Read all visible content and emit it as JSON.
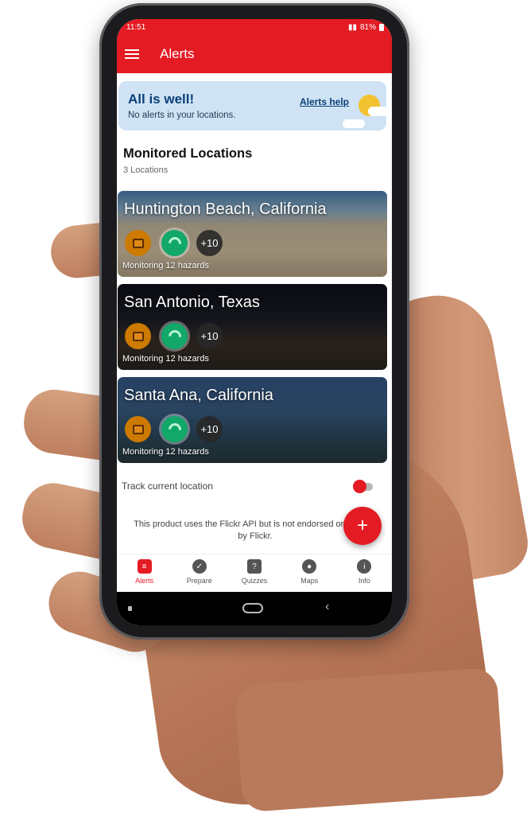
{
  "status_bar": {
    "time": "11:51",
    "battery": "81%"
  },
  "app_bar": {
    "title": "Alerts"
  },
  "banner": {
    "title": "All is well!",
    "subtitle": "No alerts in your locations.",
    "help_link": "Alerts help"
  },
  "monitored": {
    "title": "Monitored Locations",
    "count_label": "3 Locations"
  },
  "locations": [
    {
      "name": "Huntington Beach, California",
      "more": "+10",
      "monitoring": "Monitoring 12 hazards"
    },
    {
      "name": "San Antonio, Texas",
      "more": "+10",
      "monitoring": "Monitoring 12 hazards"
    },
    {
      "name": "Santa Ana, California",
      "more": "+10",
      "monitoring": "Monitoring 12 hazards"
    }
  ],
  "track_location": {
    "label": "Track current location",
    "enabled": true
  },
  "disclaimer": "This product uses the Flickr API but is not endorsed or certified by Flickr.",
  "fab": {
    "icon": "plus-icon",
    "symbol": "+"
  },
  "bottom_nav": [
    {
      "label": "Alerts",
      "icon": "alerts-list-icon",
      "glyph": "≡",
      "active": true
    },
    {
      "label": "Prepare",
      "icon": "checkmark-icon",
      "glyph": "✓"
    },
    {
      "label": "Quizzes",
      "icon": "question-icon",
      "glyph": "?"
    },
    {
      "label": "Maps",
      "icon": "map-pin-icon",
      "glyph": "●"
    },
    {
      "label": "Info",
      "icon": "info-icon",
      "glyph": "i"
    }
  ],
  "system_nav": {
    "back_symbol": "‹"
  },
  "colors": {
    "accent": "#e41b23",
    "banner_bg": "#cfe3f4",
    "banner_text": "#0b3f78"
  }
}
